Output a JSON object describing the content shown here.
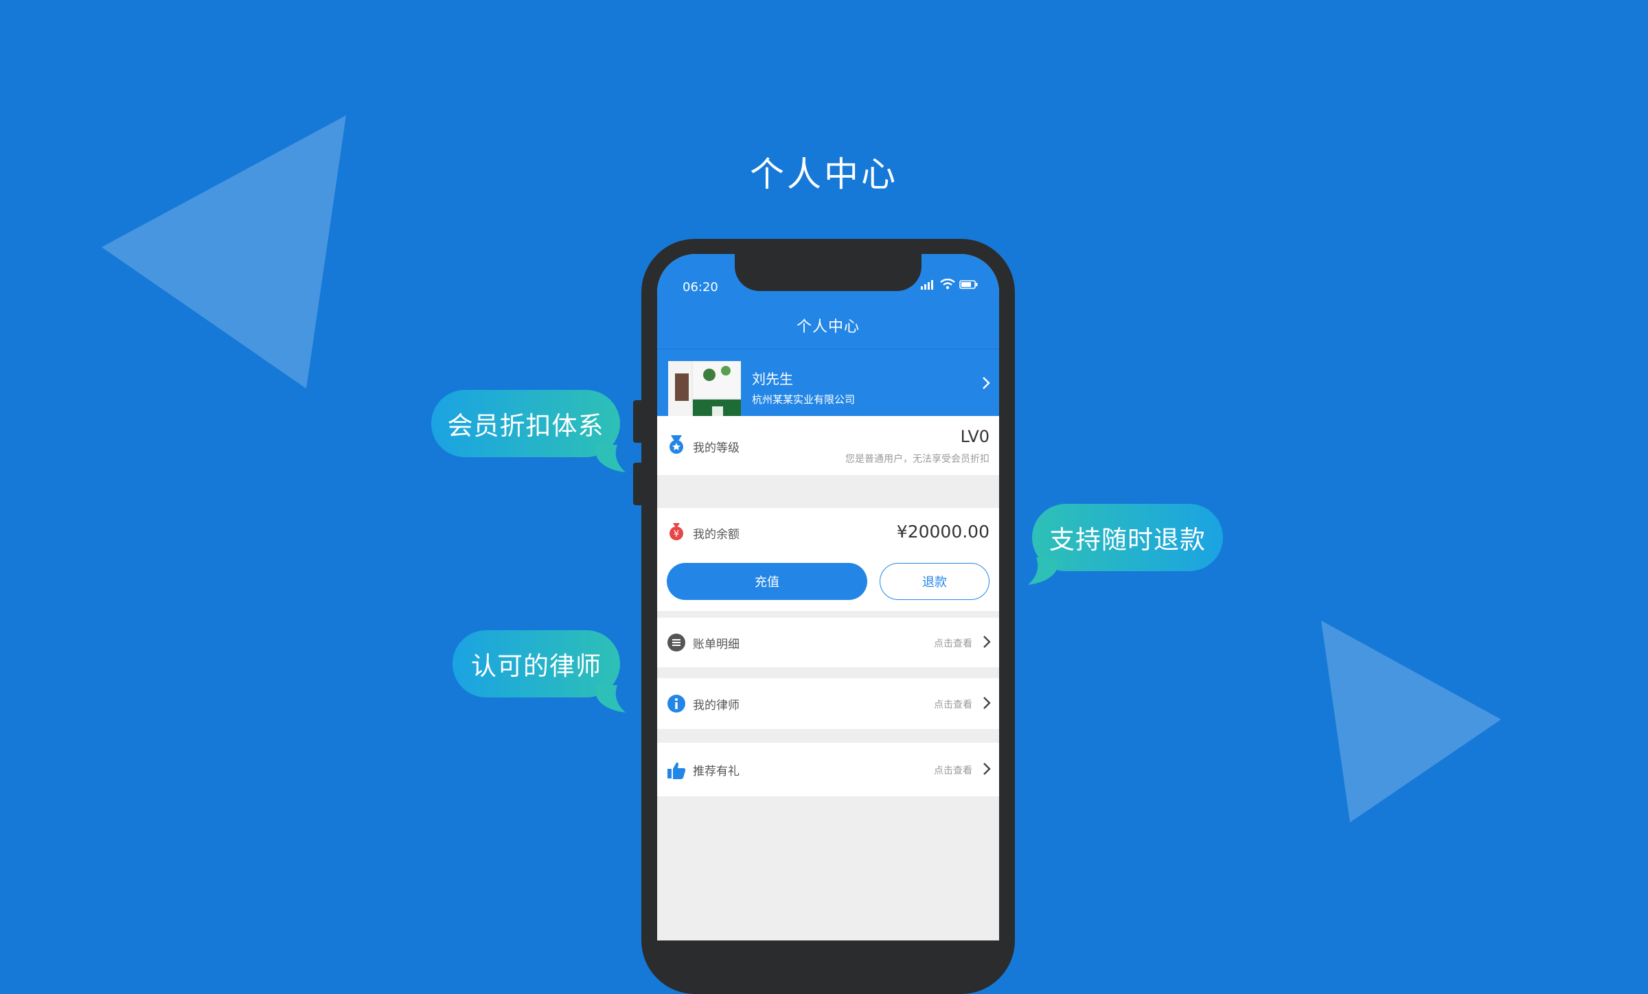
{
  "colors": {
    "background": "#1679d8",
    "accent": "#2386e6",
    "bubble_gradient_start": "#1ba3e2",
    "bubble_gradient_end": "#2ec0b6",
    "phone_frame": "#2b2c2e"
  },
  "page_heading": "个人中心",
  "bubbles": [
    {
      "text": "会员折扣体系"
    },
    {
      "text": "支持随时退款"
    },
    {
      "text": "认可的律师"
    }
  ],
  "phone": {
    "status_bar": {
      "time": "06:20",
      "icons": [
        "signal-icon",
        "wifi-icon",
        "battery-icon"
      ]
    },
    "nav_title": "个人中心",
    "profile": {
      "name": "刘先生",
      "company": "杭州某某实业有限公司"
    },
    "level": {
      "label": "我的等级",
      "value": "LV0",
      "note": "您是普通用户，无法享受会员折扣"
    },
    "balance": {
      "label": "我的余额",
      "value": "¥20000.00",
      "recharge_label": "充值",
      "refund_label": "退款"
    },
    "menu": [
      {
        "label": "账单明细",
        "hint": "点击查看",
        "icon": "list-icon"
      },
      {
        "label": "我的律师",
        "hint": "点击查看",
        "icon": "info-icon"
      },
      {
        "label": "推荐有礼",
        "hint": "点击查看",
        "icon": "thumbs-up-icon"
      }
    ]
  }
}
